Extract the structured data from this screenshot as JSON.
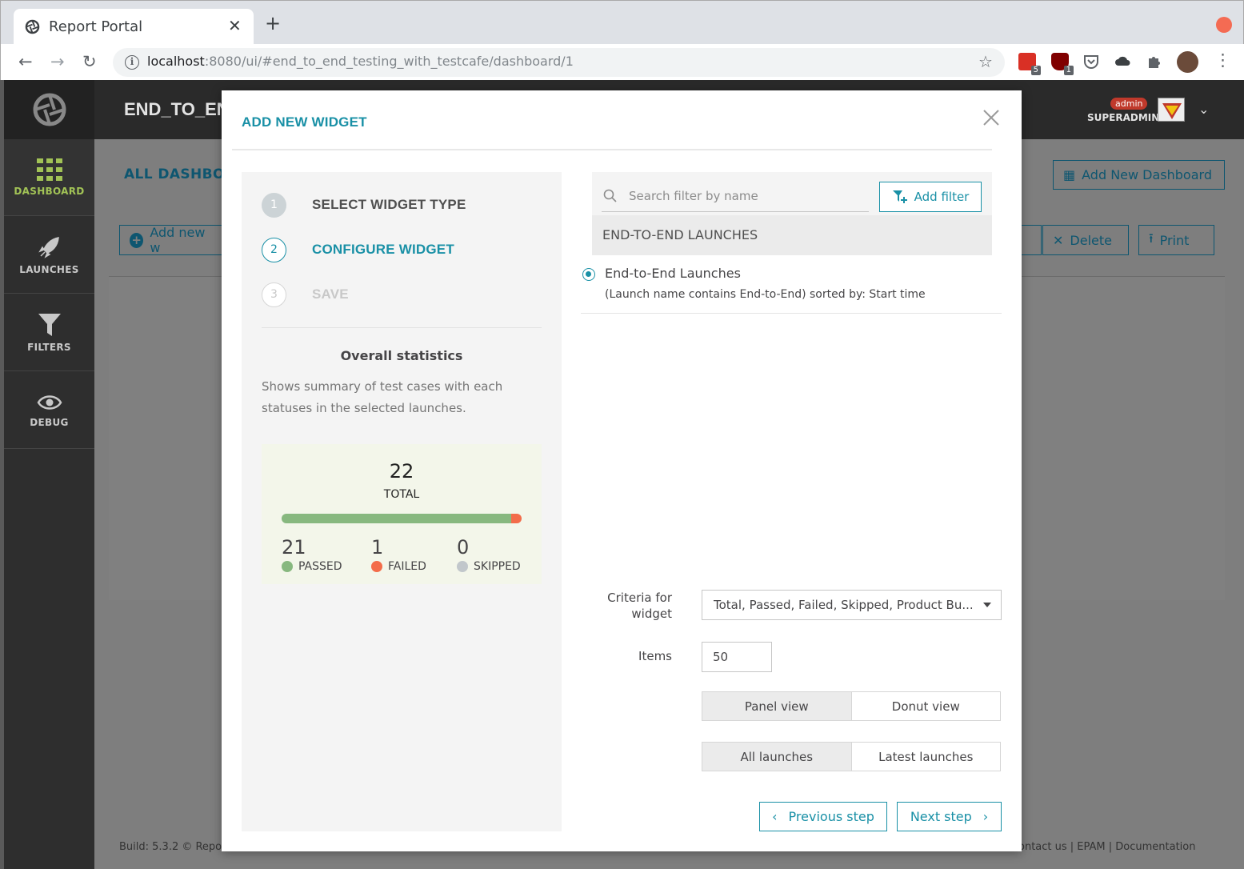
{
  "browser": {
    "tab_title": "Report Portal",
    "url_host": "localhost",
    "url_rest": ":8080/ui/#end_to_end_testing_with_testcafe/dashboard/1",
    "ext_badge_1": "5",
    "ext_badge_2": "1"
  },
  "sidebar": {
    "items": [
      {
        "label": "DASHBOARD",
        "icon": "grid-icon"
      },
      {
        "label": "LAUNCHES",
        "icon": "rocket-icon"
      },
      {
        "label": "FILTERS",
        "icon": "filter-icon"
      },
      {
        "label": "DEBUG",
        "icon": "eye-icon"
      }
    ]
  },
  "header": {
    "project": "END_TO_END",
    "role_badge": "admin",
    "user_role": "SUPERADMIN"
  },
  "content": {
    "title": "ALL DASHBOA",
    "add_new_widget": "Add new w",
    "add_new_dashboard": "Add New Dashboard",
    "delete": "Delete",
    "print": "Print",
    "footer_left": "Build: 5.3.2   © Repo",
    "footer_right": "ontact us   |   EPAM   |   Documentation"
  },
  "modal": {
    "title": "ADD NEW WIDGET",
    "steps": [
      {
        "num": "1",
        "label": "SELECT WIDGET TYPE"
      },
      {
        "num": "2",
        "label": "CONFIGURE WIDGET"
      },
      {
        "num": "3",
        "label": "SAVE"
      }
    ],
    "widget": {
      "title": "Overall statistics",
      "description": "Shows summary of test cases with each statuses in the selected launches.",
      "preview": {
        "total": "22",
        "total_label": "TOTAL",
        "passed": "21",
        "passed_label": "PASSED",
        "failed": "1",
        "failed_label": "FAILED",
        "skipped": "0",
        "skipped_label": "SKIPPED",
        "passed_fraction": 0.955,
        "failed_fraction": 0.045
      }
    },
    "search": {
      "placeholder": "Search filter by name"
    },
    "add_filter": "Add filter",
    "filter_group": "END-TO-END LAUNCHES",
    "filter": {
      "name": "End-to-End Launches",
      "description": "(Launch name contains End-to-End) sorted by: Start time",
      "selected": true
    },
    "criteria_label_1": "Criteria for",
    "criteria_label_2": "widget",
    "criteria_value": "Total, Passed, Failed, Skipped, Product Bu...",
    "items_label": "Items",
    "items_value": "50",
    "view_toggle": {
      "options": [
        "Panel view",
        "Donut view"
      ],
      "selected": "Panel view"
    },
    "launch_toggle": {
      "options": [
        "All launches",
        "Latest launches"
      ],
      "selected": "All launches"
    },
    "prev_step": "Previous step",
    "next_step": "Next step"
  },
  "colors": {
    "accent": "#1990a6",
    "passed": "#87b87f",
    "failed": "#f36c4a",
    "skipped": "#c1c7cb",
    "sidebar_active": "#a2c356"
  }
}
